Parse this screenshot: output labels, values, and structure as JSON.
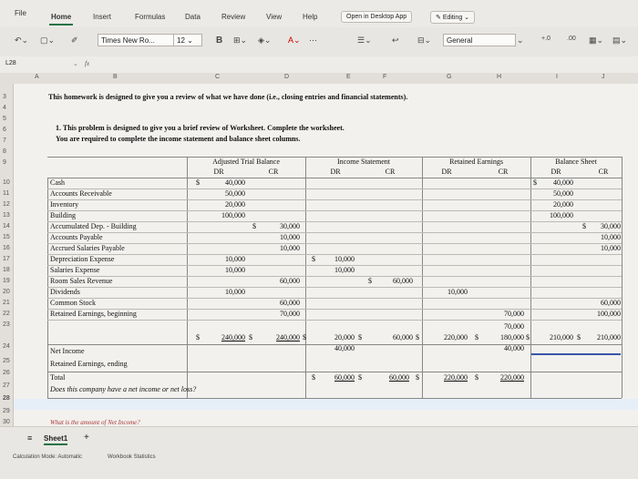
{
  "ribbon_tabs": [
    "File",
    "Home",
    "Insert",
    "Formulas",
    "Data",
    "Review",
    "View",
    "Help"
  ],
  "open_desktop": "Open in Desktop App",
  "editing": "Editing",
  "font_name": "Times New Ro...",
  "font_size": "12",
  "bold_label": "B",
  "number_format": "General",
  "cell_ref": "L28",
  "fx": "fx",
  "columns": [
    "A",
    "B",
    "C",
    "D",
    "E",
    "F",
    "G",
    "H",
    "I",
    "J"
  ],
  "rows": [
    "3",
    "4",
    "5",
    "6",
    "7",
    "8",
    "9",
    "10",
    "11",
    "12",
    "13",
    "14",
    "15",
    "16",
    "17",
    "18",
    "19",
    "20",
    "21",
    "22",
    "23",
    "24",
    "25",
    "26",
    "27",
    "28",
    "29",
    "30"
  ],
  "intro": "This homework is designed to give you a review of what we have done (i.e., closing entries and financial statements).",
  "problem_line1": "1. This problem is designed to give you a brief review of Worksheet. Complete the worksheet.",
  "problem_line2": "You are required to complete the income statement and balance sheet columns.",
  "headers": {
    "atb": "Adjusted Trial Balance",
    "is": "Income Statement",
    "re": "Retained Earnings",
    "bs": "Balance Sheet",
    "dr": "DR",
    "cr": "CR"
  },
  "accounts": [
    "Cash",
    "Accounts Receivable",
    "Inventory",
    "Building",
    "Accumulated Dep. - Building",
    "Accounts Payable",
    "Accrued Salaries Payable",
    "Depreciation Expense",
    "Salaries Expense",
    "Room Sales Revenue",
    "Dividends",
    "Common Stock",
    "Retained Earnings, beginning"
  ],
  "atb_dr": [
    "40,000",
    "50,000",
    "20,000",
    "100,000",
    "",
    "",
    "",
    "10,000",
    "10,000",
    "",
    "10,000",
    "",
    ""
  ],
  "atb_cr": [
    "",
    "",
    "",
    "",
    "30,000",
    "10,000",
    "10,000",
    "",
    "",
    "60,000",
    "",
    "60,000",
    "70,000"
  ],
  "is_dr": [
    "",
    "",
    "",
    "",
    "",
    "",
    "",
    "10,000",
    "10,000",
    "",
    "",
    "",
    ""
  ],
  "is_cr": [
    "",
    "",
    "",
    "",
    "",
    "",
    "",
    "",
    "",
    "60,000",
    "",
    "",
    ""
  ],
  "re_dr": [
    "",
    "",
    "",
    "",
    "",
    "",
    "",
    "",
    "",
    "",
    "10,000",
    "",
    ""
  ],
  "re_cr": [
    "",
    "",
    "",
    "",
    "",
    "",
    "",
    "",
    "",
    "",
    "",
    "",
    "70,000"
  ],
  "bs_dr": [
    "40,000",
    "50,000",
    "20,000",
    "100,000",
    "",
    "",
    "",
    "",
    "",
    "",
    "",
    "",
    ""
  ],
  "bs_cr": [
    "",
    "",
    "",
    "",
    "30,000",
    "10,000",
    "10,000",
    "",
    "",
    "",
    "",
    "60,000",
    "100,000"
  ],
  "dollar": "$",
  "totals": {
    "atb_dr": "240,000",
    "atb_cr": "240,000",
    "is_dr": "20,000",
    "is_cr": "60,000",
    "re_dr": "220,000",
    "re_cr": "180,000",
    "bs_dr": "210,000",
    "bs_cr": "210,000",
    "re_cr_70": "70,000"
  },
  "net_income_label": "Net Income",
  "net_income_is": "40,000",
  "net_income_re": "40,000",
  "re_ending_label": "Retained Earnings, ending",
  "total_label": "Total",
  "final": {
    "is_dr": "60,000",
    "is_cr": "60,000",
    "re_dr": "220,000",
    "re_cr": "220,000"
  },
  "question1": "Does this company have a net income or net loss?",
  "question2": "What is the amount of Net Income?",
  "sheet_name": "Sheet1",
  "calc_mode": "Calculation Mode: Automatic",
  "workbook_stats": "Workbook Statistics"
}
